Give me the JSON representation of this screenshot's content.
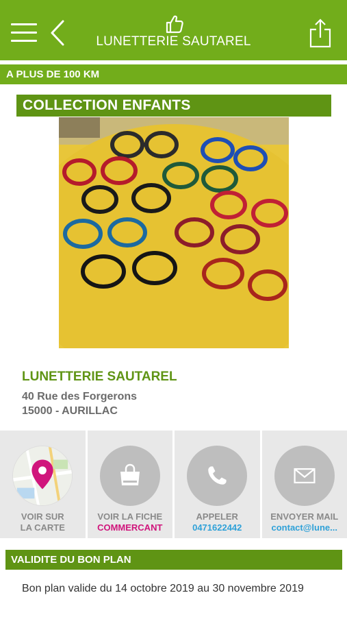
{
  "header": {
    "title": "LUNETTERIE SAUTAREL",
    "menu_icon": "hamburger-menu-icon",
    "back_icon": "chevron-left-icon",
    "logo_icon": "thumbs-up-icon",
    "share_icon": "share-icon"
  },
  "distance_label": "A PLUS DE 100 KM",
  "section_title": "COLLECTION ENFANTS",
  "shop": {
    "name": "LUNETTERIE SAUTAREL",
    "street": "40 Rue des Forgerons",
    "city": "15000 - AURILLAC"
  },
  "actions": [
    {
      "icon": "map-pin-icon",
      "line1": "VOIR SUR",
      "line2": "LA CARTE"
    },
    {
      "icon": "shopping-bag-icon",
      "line1": "VOIR LA FICHE",
      "line2": "COMMERCANT"
    },
    {
      "icon": "phone-icon",
      "line1": "APPELER",
      "line2": "0471622442"
    },
    {
      "icon": "mail-icon",
      "line1": "ENVOYER MAIL",
      "line2": "contact@lune..."
    }
  ],
  "validity": {
    "title": "VALIDITE DU BON PLAN",
    "text": "Bon plan valide du 14 octobre 2019 au 30 novembre 2019"
  },
  "colors": {
    "brand_green": "#72ad1b",
    "dark_green": "#5f9414",
    "pink_accent": "#d0157c",
    "blue_accent": "#2fa1d8"
  }
}
